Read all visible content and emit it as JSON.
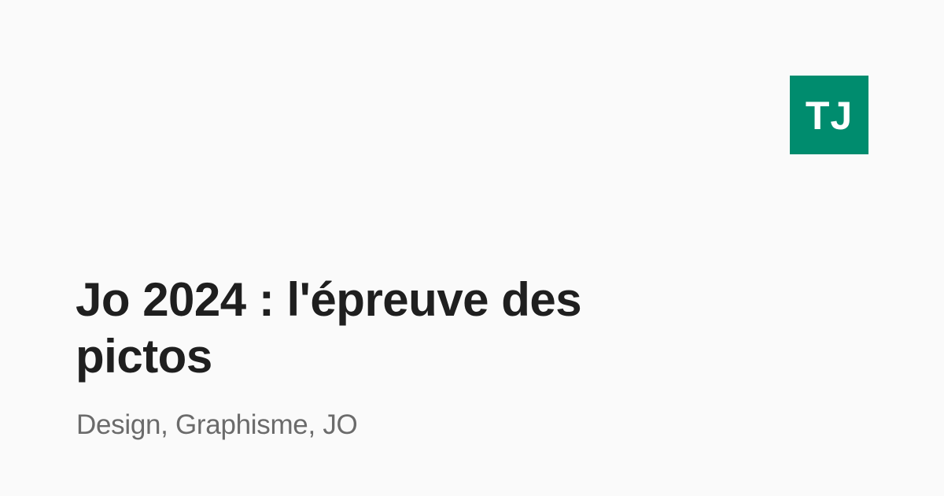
{
  "logo": {
    "text": "TJ",
    "background_color": "#008c6e",
    "text_color": "#ffffff"
  },
  "article": {
    "title": "Jo 2024 : l'épreuve des pictos",
    "tags": "Design, Graphisme, JO"
  },
  "colors": {
    "background": "#fafafa",
    "title": "#1f1f1f",
    "tags": "#6b6b6b"
  }
}
